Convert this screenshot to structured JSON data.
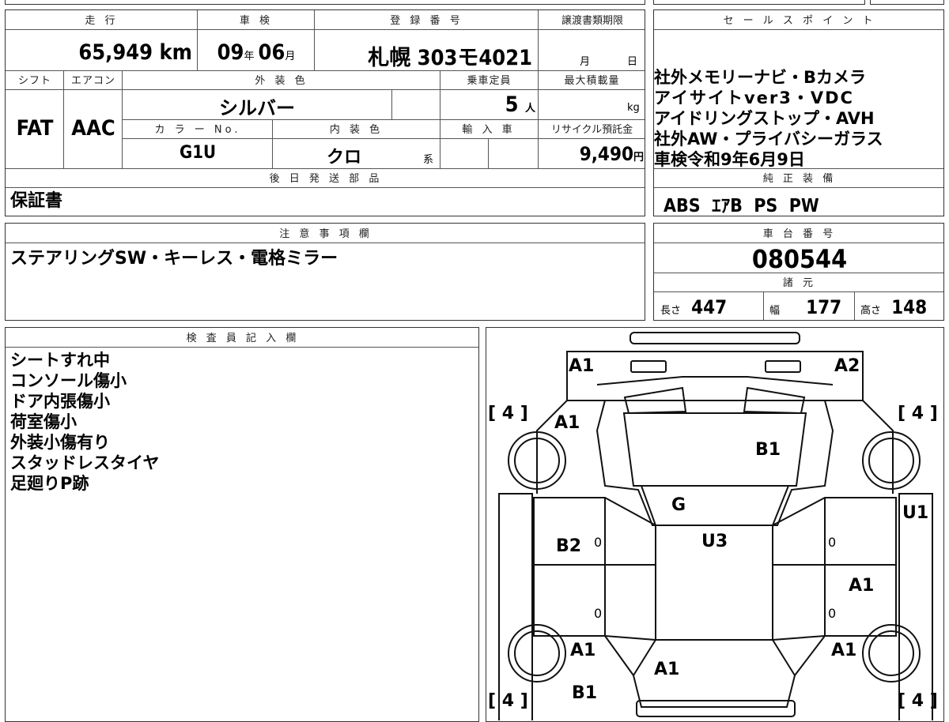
{
  "top": {
    "mileage_label": "走 行",
    "mileage_value": "65,949",
    "mileage_unit": "km",
    "shaken_label": "車 検",
    "shaken_year": "09",
    "shaken_year_unit": "年",
    "shaken_month": "06",
    "shaken_month_unit": "月",
    "reg_label": "登 録 番 号",
    "reg_value": "札幌 303モ4021",
    "transfer_label": "譲渡書類期限",
    "transfer_month_unit": "月",
    "transfer_day_unit": "日",
    "shift_label": "シフト",
    "shift_value": "FAT",
    "ac_label": "エアコン",
    "ac_value": "AAC",
    "ext_color_label": "外 装 色",
    "ext_color_value": "シルバー",
    "capacity_label": "乗車定員",
    "capacity_value": "5",
    "capacity_unit": "人",
    "max_load_label": "最大積載量",
    "max_load_unit": "kg",
    "color_no_label": "カ ラ ー No.",
    "color_no_value": "G1U",
    "int_color_label": "内 装 色",
    "int_color_value": "クロ",
    "int_color_unit": "系",
    "import_label": "輸 入 車",
    "recycle_label": "リサイクル預託金",
    "recycle_value": "9,490",
    "recycle_unit": "円",
    "later_parts_label": "後 日 発 送 部 品",
    "later_parts_value": "保証書"
  },
  "sales": {
    "label": "セ ー ル ス ポ イ ン ト",
    "lines": [
      "社外メモリーナビ・Bカメラ",
      "アイサイトver3・VDC",
      "アイドリングストップ・AVH",
      "社外AW・プライバシーガラス",
      "車検令和9年6月9日"
    ],
    "equip_label": "純 正 装 備",
    "equip_value": "ABS  ｴｱB  PS  PW"
  },
  "notes": {
    "label": "注 意 事 項 欄",
    "value": "ステアリングSW・キーレス・電格ミラー"
  },
  "chassis": {
    "label": "車 台 番 号",
    "value": "080544",
    "spec_label": "諸 元",
    "length_label": "長さ",
    "length_value": "447",
    "width_label": "幅",
    "width_value": "177",
    "height_label": "高さ",
    "height_value": "148"
  },
  "inspector": {
    "label": "検 査 員 記 入 欄",
    "lines": [
      "シートすれ中",
      "コンソール傷小",
      "ドア内張傷小",
      "荷室傷小",
      "外装小傷有り",
      "スタッドレスタイヤ",
      "足廻りP跡"
    ]
  },
  "diagram": {
    "marks": {
      "front_left": "A1",
      "front_right": "A2",
      "hood_left": "A1",
      "hood": "B1",
      "windshield": "G",
      "roof": "U3",
      "left_front_door": "B2",
      "right_front_fender": "U1",
      "right_rear_door": "A1",
      "rear_left_fender": "A1",
      "rear_right_fender": "A1",
      "trunk": "A1",
      "rear_left": "B1"
    },
    "tire_tl": "4",
    "tire_tr": "4",
    "tire_bl": "4",
    "tire_br": "4",
    "door_zero": "0"
  }
}
